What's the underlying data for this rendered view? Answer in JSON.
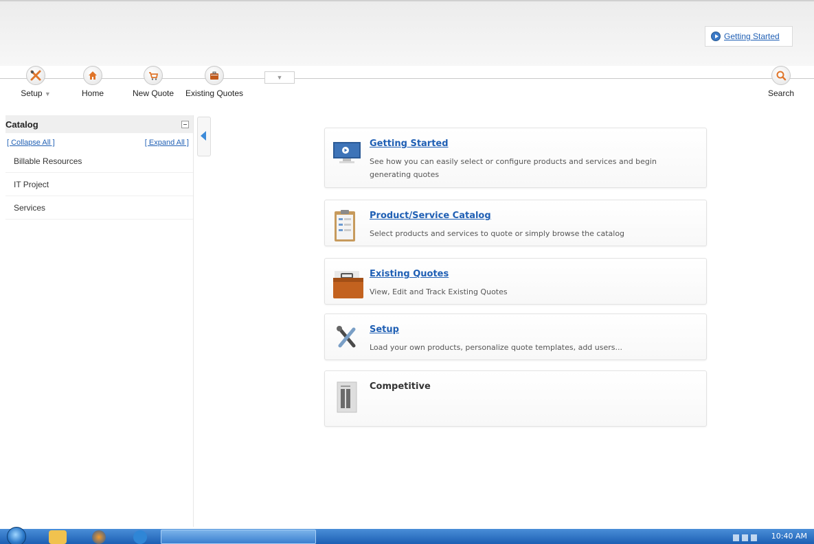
{
  "top_link": {
    "label": "Getting Started"
  },
  "toolbar": {
    "items": [
      {
        "label": "Setup",
        "has_dropdown": true,
        "icon": "wrench-screwdriver-icon"
      },
      {
        "label": "Home",
        "icon": "home-icon"
      },
      {
        "label": "New Quote",
        "icon": "cart-icon"
      },
      {
        "label": "Existing Quotes",
        "icon": "briefcase-icon"
      }
    ],
    "dropdown_glyph": "▼",
    "search_label": "Search"
  },
  "sidebar": {
    "title": "Catalog",
    "collapse_all": "[ Collapse All ]",
    "expand_all": "[ Expand All ]",
    "items": [
      "Billable Resources",
      "IT Project",
      "Services"
    ]
  },
  "cards": [
    {
      "title": "Getting Started",
      "description": "See how you can easily select or configure products and services and begin generating quotes",
      "icon": "monitor-play-icon",
      "is_link": true
    },
    {
      "title": "Product/Service Catalog",
      "description": "Select products and services to quote or simply browse the catalog",
      "icon": "clipboard-icon",
      "is_link": true
    },
    {
      "title": "Existing Quotes",
      "description": "View, Edit and Track Existing Quotes",
      "icon": "briefcase-icon",
      "is_link": true
    },
    {
      "title": "Setup",
      "description": "Load your own products, personalize quote templates, add users...",
      "icon": "wrench-screwdriver-icon",
      "is_link": true
    },
    {
      "title": "Competitive",
      "description": "",
      "icon": "document-columns-icon",
      "is_link": false
    }
  ],
  "taskbar": {
    "clock": "10:40 AM"
  },
  "colors": {
    "link": "#1f5fb4",
    "accent_orange": "#e0752a",
    "taskbar": "#1c5fb3"
  }
}
